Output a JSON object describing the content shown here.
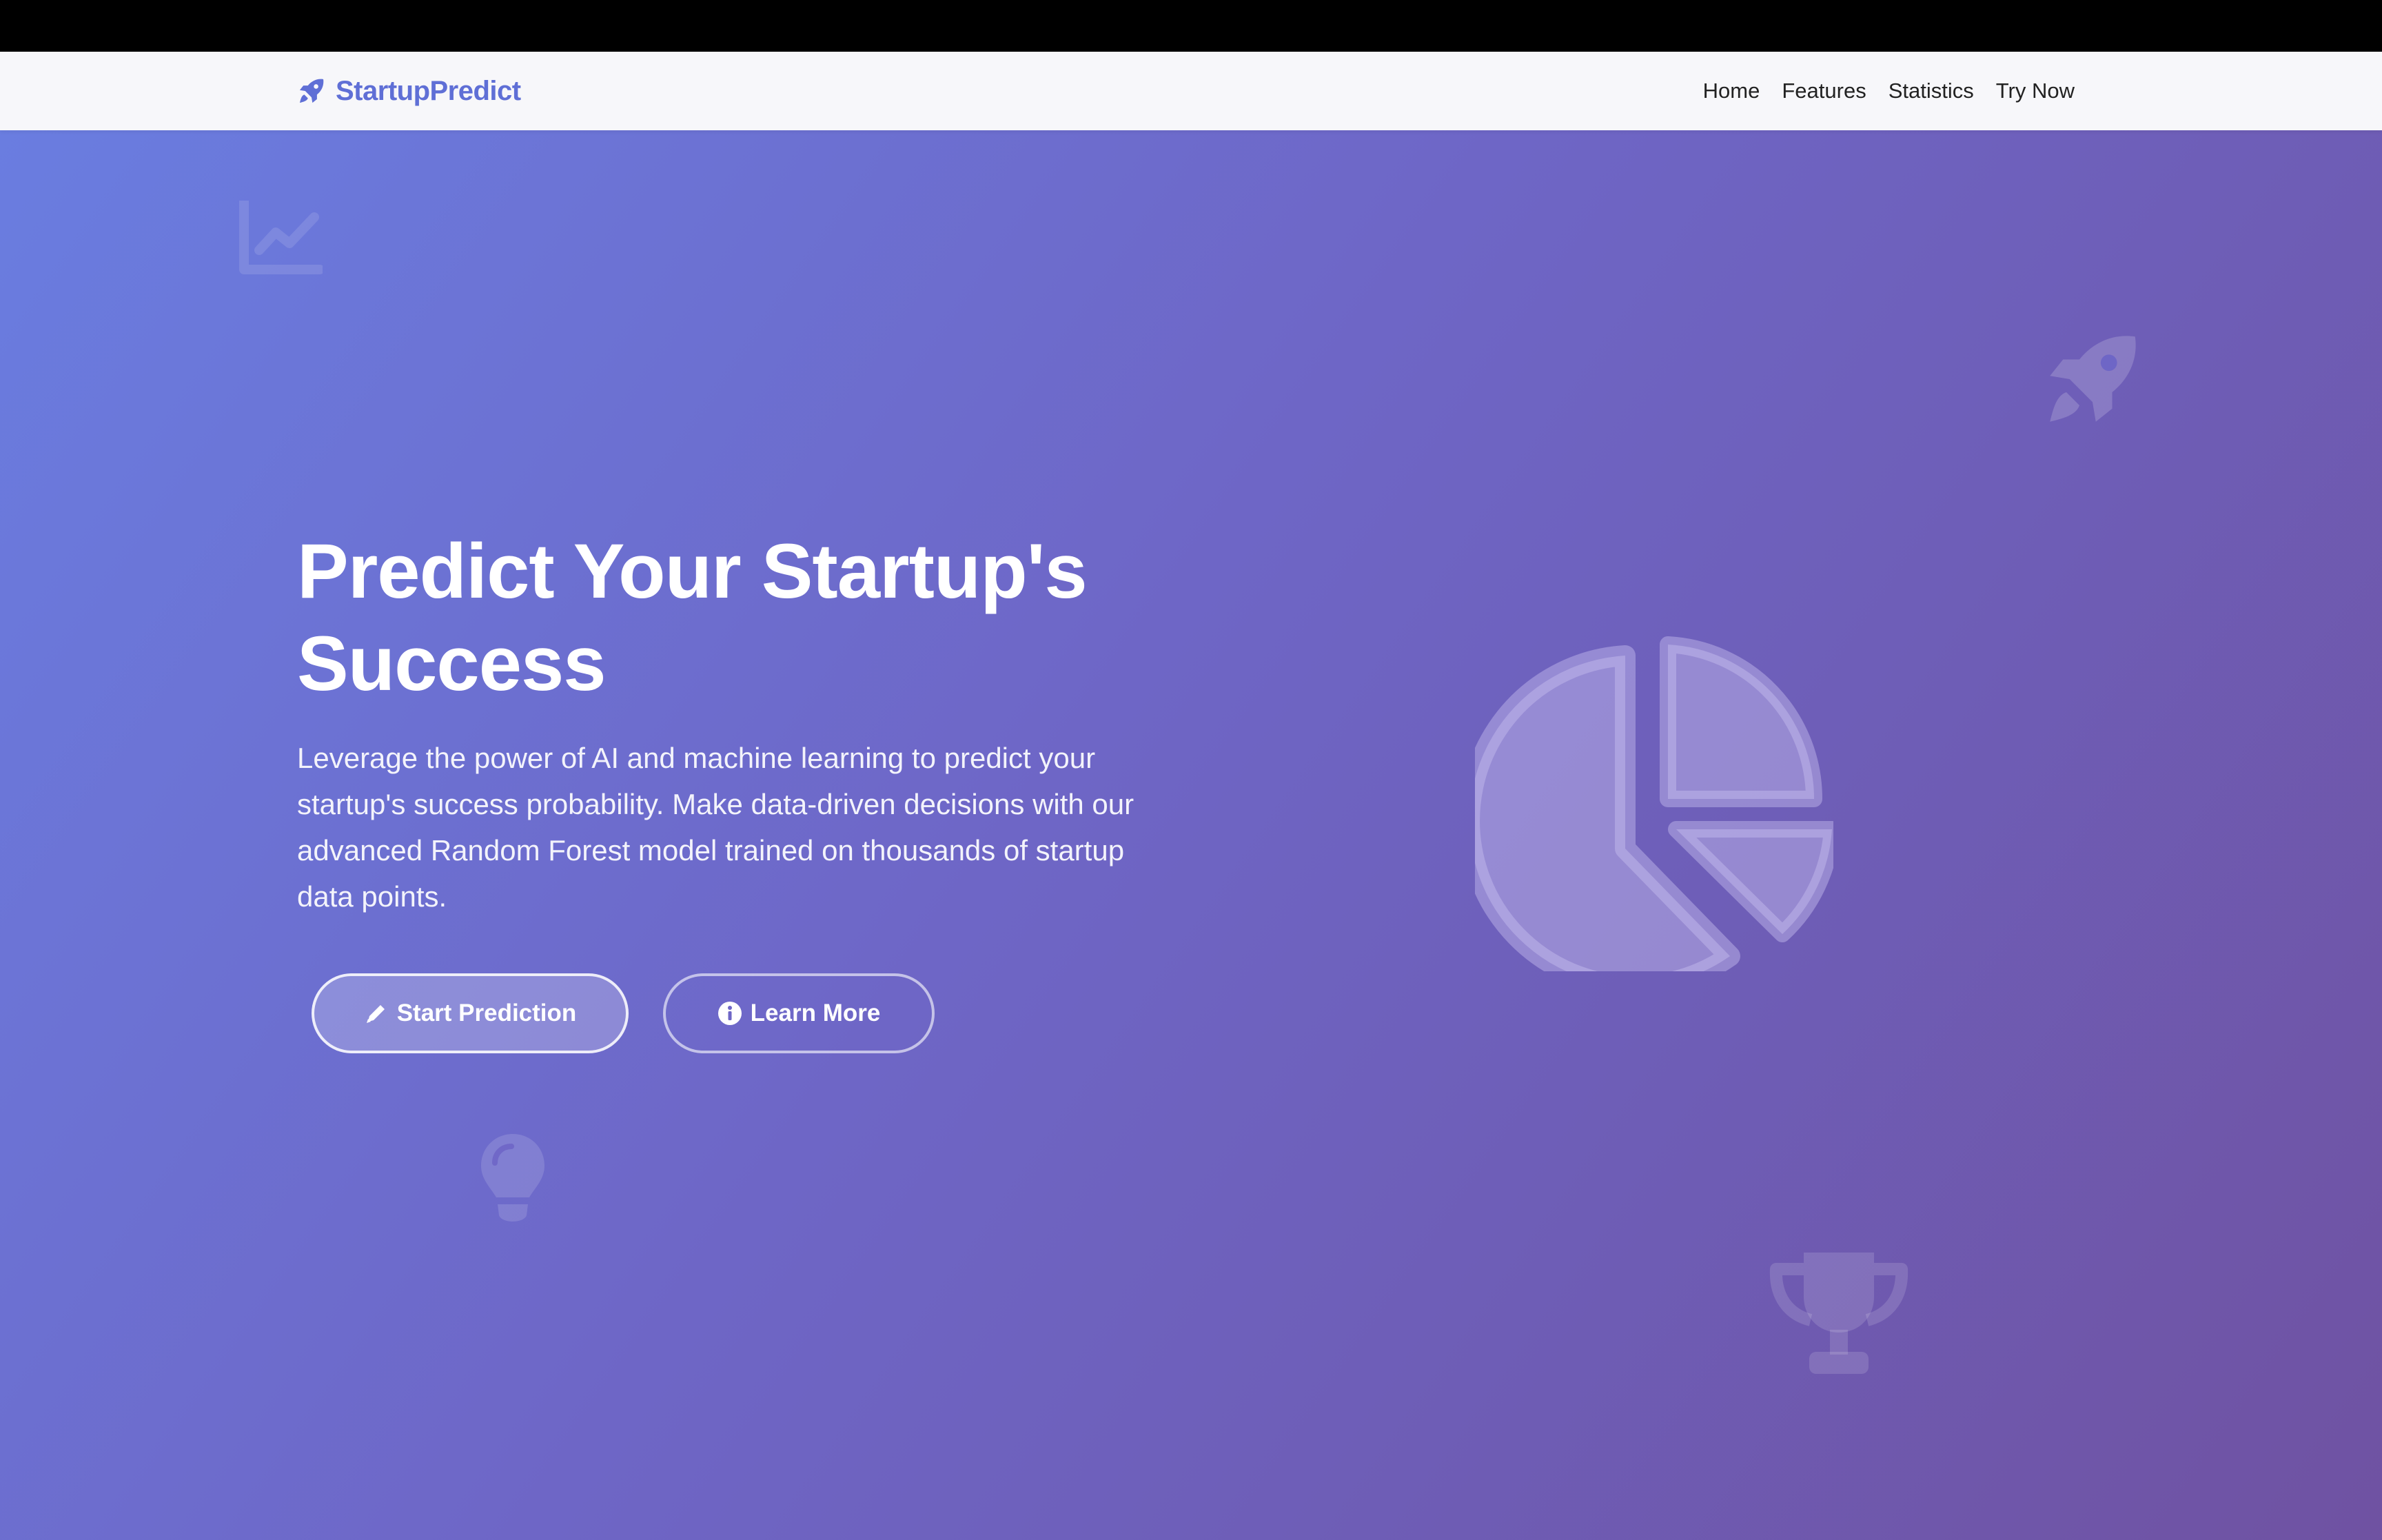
{
  "navbar": {
    "brand": "StartupPredict",
    "brand_icon": "rocket-icon",
    "links": [
      {
        "label": "Home"
      },
      {
        "label": "Features"
      },
      {
        "label": "Statistics"
      },
      {
        "label": "Try Now"
      }
    ]
  },
  "hero": {
    "title": "Predict Your Startup's Success",
    "description": "Leverage the power of AI and machine learning to predict your startup's success probability. Make data-driven decisions with our advanced Random Forest model trained on thousands of startup data points.",
    "primary_button": {
      "label": "Start Prediction",
      "icon": "pencil-icon"
    },
    "secondary_button": {
      "label": "Learn More",
      "icon": "info-circle-icon"
    },
    "decorative_icons": [
      "chart-line-icon",
      "rocket-icon",
      "pie-chart-icon",
      "lightbulb-icon",
      "trophy-icon"
    ]
  },
  "colors": {
    "brand": "#5f6fd6",
    "gradient_start": "#6a7de0",
    "gradient_end": "#6f52a2",
    "nav_background": "#f7f7fa"
  }
}
